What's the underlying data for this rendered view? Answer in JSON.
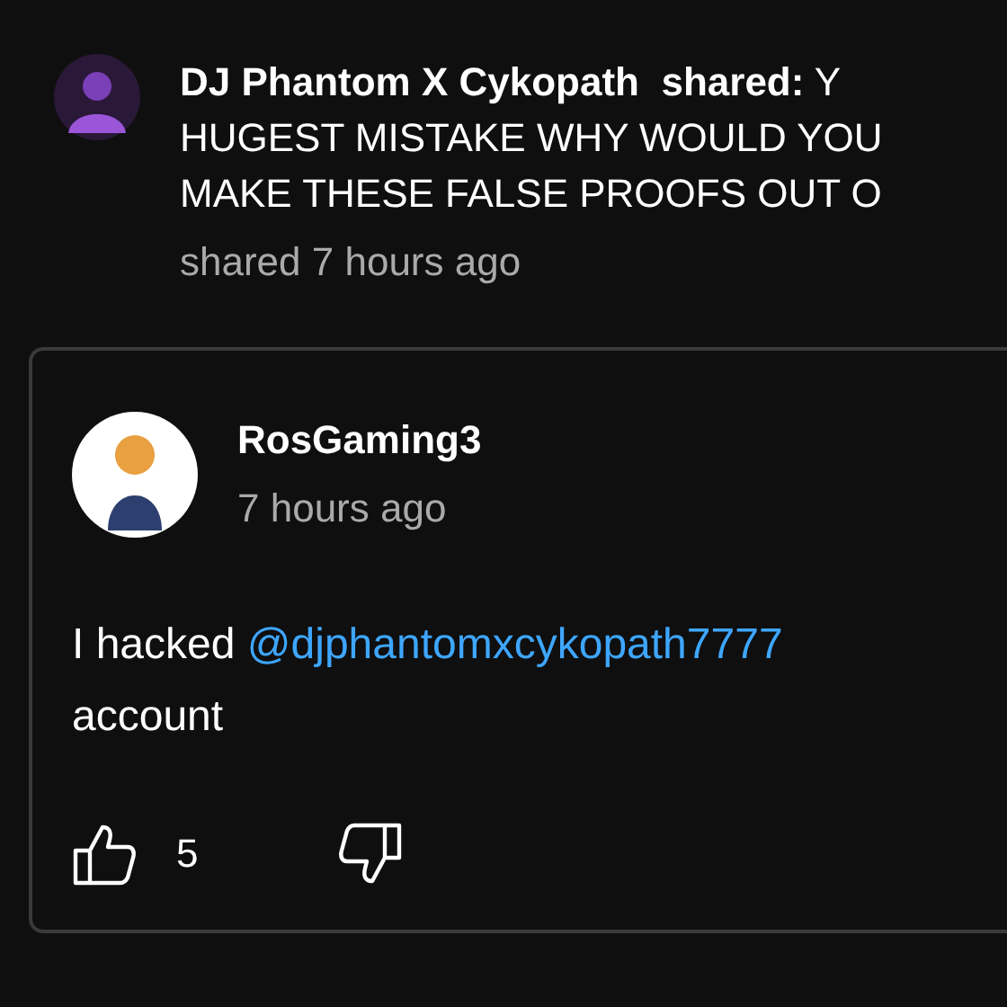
{
  "share": {
    "author": "DJ Phantom X Cykopath",
    "verb": "shared:",
    "message_lines": [
      "Y",
      "HUGEST MISTAKE WHY WOULD YOU",
      "MAKE THESE FALSE PROOFS OUT O"
    ],
    "time": "shared 7 hours ago"
  },
  "comment": {
    "author": "RosGaming3",
    "time": "7 hours ago",
    "text_before": "I hacked",
    "mention": "@djphantomxcykopath7777",
    "text_after": "account",
    "likes": "5",
    "liked": false,
    "disliked": false
  }
}
